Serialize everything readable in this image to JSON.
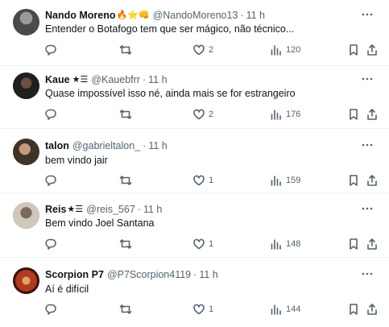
{
  "tweets": [
    {
      "name": "Nando Moreno",
      "emoji": "🔥⭐👊",
      "handle": "@NandoMoreno13",
      "time": "11 h",
      "text": "Entender o Botafogo tem que ser mágico, não técnico...",
      "replies": "",
      "retweets": "",
      "likes": "2",
      "views": "120",
      "avatar_color": "#5a5a5a"
    },
    {
      "name": "Kaue",
      "emoji": "★☰",
      "handle": "@Kauebfrr",
      "time": "11 h",
      "text": "Quase impossível isso né, ainda mais se for estrangeiro",
      "replies": "",
      "retweets": "",
      "likes": "2",
      "views": "176",
      "avatar_color": "#2b2b2b"
    },
    {
      "name": "talon",
      "emoji": "",
      "handle": "@gabrieltalon_",
      "time": "11 h",
      "text": "bem vindo jair",
      "replies": "",
      "retweets": "",
      "likes": "1",
      "views": "159",
      "avatar_color": "#7a5f4a"
    },
    {
      "name": "Reis",
      "emoji": "★☰",
      "handle": "@reis_567",
      "time": "11 h",
      "text": "Bem vindo Joel Santana",
      "replies": "",
      "retweets": "",
      "likes": "1",
      "views": "148",
      "avatar_color": "#a89c8c"
    },
    {
      "name": "Scorpion P7",
      "emoji": "",
      "handle": "@P7Scorpion4119",
      "time": "11 h",
      "text": "Aí é difícil",
      "replies": "",
      "retweets": "",
      "likes": "1",
      "views": "144",
      "avatar_color": "#8a2a1c"
    }
  ],
  "colors": {
    "text_primary": "#0f1419",
    "text_secondary": "#536471",
    "divider": "#eff3f4"
  },
  "icons": [
    "more-icon",
    "reply-icon",
    "retweet-icon",
    "like-icon",
    "views-icon",
    "bookmark-icon",
    "share-icon"
  ]
}
